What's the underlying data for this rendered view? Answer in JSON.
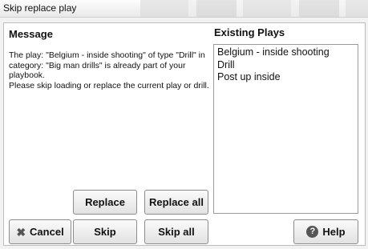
{
  "window": {
    "title": "Skip replace play"
  },
  "message": {
    "heading": "Message",
    "lines": [
      "The play: \"Belgium - inside shooting\" of type \"Drill\" in",
      "category: \"Big man drills\" is already part of your",
      "playbook.",
      "Please skip loading or replace the current play or drill."
    ]
  },
  "existing_plays": {
    "heading": "Existing Plays",
    "items": [
      "Belgium - inside shooting",
      "Drill",
      "Post up inside"
    ]
  },
  "buttons": {
    "replace": "Replace",
    "replace_all": "Replace all",
    "cancel": "Cancel",
    "skip": "Skip",
    "skip_all": "Skip all",
    "help": "Help"
  },
  "icons": {
    "cancel": "close-icon",
    "help": "help-icon"
  }
}
